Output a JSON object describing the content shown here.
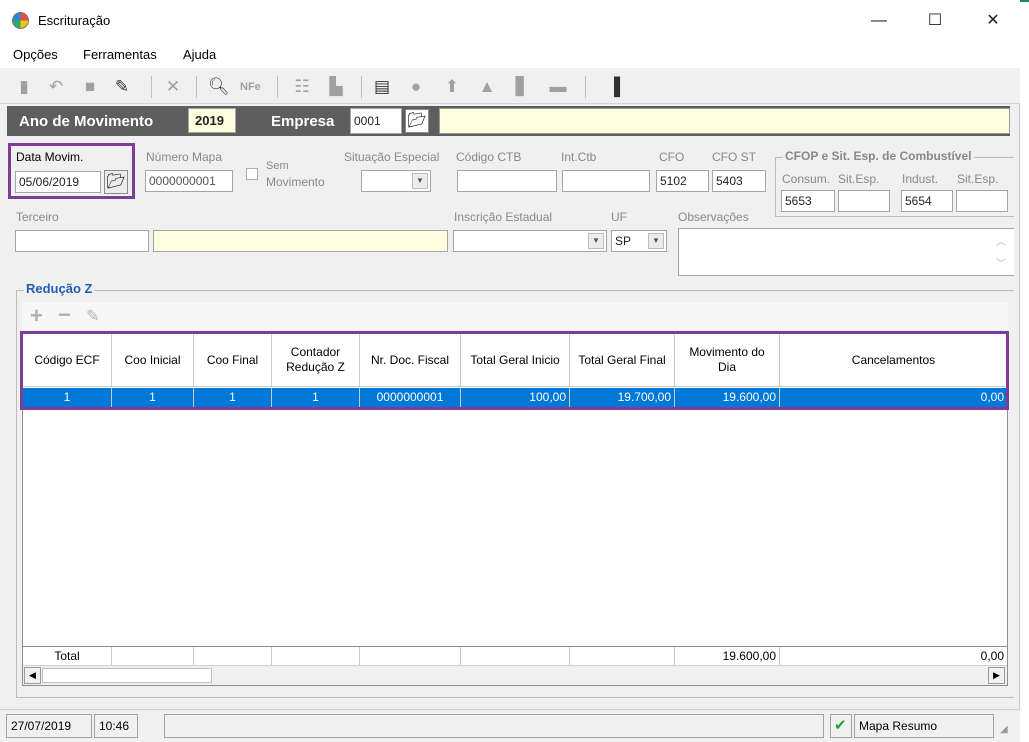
{
  "window": {
    "title": "Escrituração",
    "minimize": "—",
    "maximize": "☐",
    "close": "✕"
  },
  "menu": {
    "items": [
      "Opções",
      "Ferramentas",
      "Ajuda"
    ]
  },
  "toolbar": {
    "icons": [
      "new-icon",
      "undo-icon",
      "stop-icon",
      "write-icon",
      "delete-icon",
      "preview-icon",
      "nfe-icon",
      "tree-icon",
      "truck-icon",
      "edit-doc-icon",
      "apple-icon",
      "upload-icon",
      "house-icon",
      "list-icon",
      "dash-icon",
      "exit-door-icon"
    ],
    "nfe_label": "NFe"
  },
  "header": {
    "ano_label": "Ano de Movimento",
    "ano_value": "2019",
    "empresa_label": "Empresa",
    "empresa_value": "0001"
  },
  "form": {
    "data_movim_label": "Data Movim.",
    "data_movim_value": "05/06/2019",
    "numero_mapa_label": "Número Mapa",
    "numero_mapa_value": "0000000001",
    "sem_movimento_label_1": "Sem",
    "sem_movimento_label_2": "Movimento",
    "situacao_especial_label": "Situação Especial",
    "codigo_ctb_label": "Código CTB",
    "int_ctb_label": "Int.Ctb",
    "cfo_label": "CFO",
    "cfo_value": "5102",
    "cfo_st_label": "CFO ST",
    "cfo_st_value": "5403",
    "combustivel_title": "CFOP e Sit. Esp. de Combustível",
    "consum_label": "Consum.",
    "sit_esp_label_1": "Sit.Esp.",
    "indust_label": "Indust.",
    "sit_esp_label_2": "Sit.Esp.",
    "consum_value": "5653",
    "indust_value": "5654",
    "terceiro_label": "Terceiro",
    "inscricao_label": "Inscrição Estadual",
    "uf_label": "UF",
    "uf_value": "SP",
    "observacoes_label": "Observações"
  },
  "reducao": {
    "title": "Redução Z",
    "add": "+",
    "remove": "−",
    "edit": "✎",
    "columns": [
      "Código ECF",
      "Coo Inicial",
      "Coo Final",
      "Contador\nRedução Z",
      "Nr. Doc. Fiscal",
      "Total Geral Inicio",
      "Total Geral Final",
      "Movimento do\nDia",
      "Cancelamentos"
    ],
    "rows": [
      [
        "1",
        "1",
        "1",
        "1",
        "0000000001",
        "100,00",
        "19.700,00",
        "19.600,00",
        "0,00"
      ]
    ],
    "footer": {
      "label": "Total",
      "movimento": "19.600,00",
      "cancelamentos": "0,00"
    }
  },
  "status": {
    "date": "27/07/2019",
    "time": "10:46",
    "check": "✔",
    "mode": "Mapa Resumo"
  }
}
